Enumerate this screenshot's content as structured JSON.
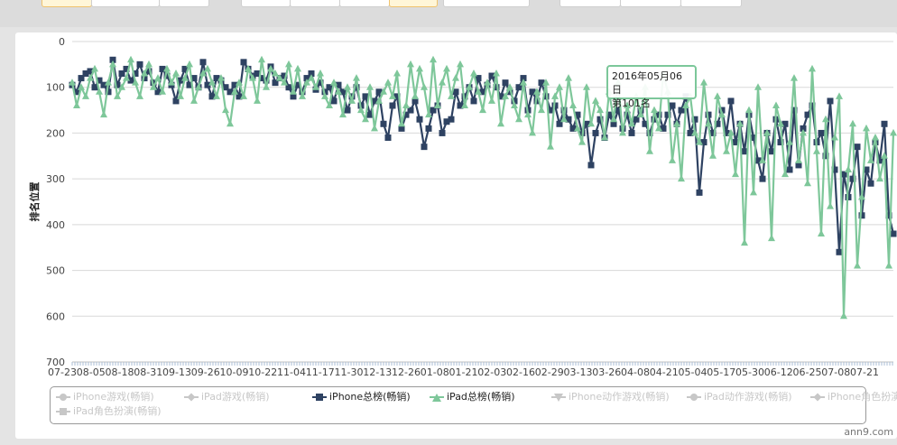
{
  "chart_data": {
    "type": "line",
    "ylabel": "排名位置",
    "ylim": [
      0,
      700
    ],
    "y_reversed": true,
    "yticks": [
      0,
      100,
      200,
      300,
      400,
      500,
      600,
      700
    ],
    "x_tick_labels": [
      "07-23",
      "08-05",
      "08-18",
      "08-31",
      "09-13",
      "09-26",
      "10-09",
      "10-22",
      "11-04",
      "11-17",
      "11-30",
      "12-13",
      "12-26",
      "01-08",
      "01-21",
      "02-03",
      "02-16",
      "02-29",
      "03-13",
      "03-26",
      "04-08",
      "04-21",
      "05-04",
      "05-17",
      "05-30",
      "06-12",
      "06-25",
      "07-08",
      "07-21"
    ],
    "series": [
      {
        "name": "iPhone总榜(畅销)",
        "color": "#2e4262",
        "marker": "square",
        "values": [
          95,
          110,
          80,
          70,
          65,
          100,
          85,
          95,
          110,
          40,
          95,
          70,
          60,
          85,
          70,
          50,
          80,
          65,
          90,
          110,
          60,
          75,
          95,
          130,
          85,
          60,
          95,
          80,
          100,
          45,
          95,
          120,
          80,
          85,
          100,
          110,
          95,
          120,
          45,
          60,
          75,
          70,
          80,
          85,
          55,
          90,
          80,
          75,
          100,
          120,
          95,
          110,
          80,
          70,
          105,
          90,
          110,
          100,
          130,
          95,
          110,
          150,
          120,
          100,
          140,
          120,
          160,
          130,
          110,
          180,
          210,
          140,
          120,
          190,
          160,
          150,
          130,
          170,
          230,
          190,
          150,
          140,
          200,
          175,
          170,
          110,
          140,
          120,
          100,
          130,
          80,
          110,
          95,
          75,
          100,
          120,
          90,
          110,
          130,
          100,
          80,
          150,
          110,
          130,
          90,
          120,
          150,
          140,
          180,
          150,
          170,
          190,
          160,
          200,
          180,
          270,
          200,
          170,
          210,
          160,
          180,
          150,
          190,
          160,
          200,
          170,
          150,
          180,
          200,
          170,
          160,
          190,
          160,
          140,
          180,
          150,
          120,
          200,
          170,
          330,
          220,
          160,
          200,
          180,
          150,
          200,
          130,
          220,
          180,
          240,
          160,
          210,
          260,
          300,
          200,
          240,
          170,
          220,
          180,
          280,
          150,
          270,
          190,
          160,
          140,
          220,
          200,
          250,
          130,
          280,
          460,
          290,
          340,
          300,
          230,
          380,
          280,
          310,
          220,
          260,
          180,
          380,
          420
        ]
      },
      {
        "name": "iPad总榜(畅销)",
        "color": "#7ec79a",
        "marker": "triangle",
        "values": [
          90,
          140,
          100,
          120,
          80,
          60,
          110,
          160,
          90,
          50,
          120,
          100,
          80,
          40,
          90,
          120,
          70,
          50,
          100,
          80,
          110,
          60,
          90,
          70,
          120,
          80,
          50,
          130,
          100,
          70,
          60,
          90,
          120,
          80,
          150,
          180,
          110,
          90,
          120,
          60,
          80,
          130,
          40,
          100,
          60,
          70,
          80,
          90,
          50,
          110,
          60,
          120,
          90,
          80,
          100,
          70,
          120,
          140,
          90,
          110,
          160,
          100,
          130,
          80,
          150,
          170,
          100,
          190,
          130,
          110,
          90,
          120,
          70,
          180,
          140,
          50,
          120,
          60,
          100,
          160,
          40,
          140,
          90,
          60,
          120,
          80,
          50,
          140,
          100,
          70,
          110,
          150,
          90,
          130,
          70,
          180,
          120,
          100,
          140,
          170,
          90,
          160,
          200,
          110,
          150,
          90,
          230,
          120,
          100,
          170,
          80,
          140,
          190,
          220,
          100,
          180,
          130,
          150,
          210,
          110,
          170,
          90,
          200,
          140,
          180,
          120,
          160,
          100,
          240,
          150,
          190,
          70,
          110,
          260,
          180,
          300,
          140,
          120,
          200,
          220,
          90,
          180,
          250,
          120,
          160,
          240,
          200,
          290,
          180,
          440,
          150,
          330,
          100,
          260,
          200,
          430,
          140,
          180,
          290,
          220,
          80,
          260,
          200,
          310,
          60,
          240,
          420,
          170,
          360,
          210,
          120,
          600,
          280,
          180,
          490,
          340,
          190,
          260,
          210,
          300,
          250,
          490,
          200
        ]
      }
    ],
    "legend": {
      "items": [
        {
          "label": "iPhone游戏(畅销)",
          "active": false,
          "marker": "circle"
        },
        {
          "label": "iPad游戏(畅销)",
          "active": false,
          "marker": "diamond"
        },
        {
          "label": "iPhone总榜(畅销)",
          "active": true,
          "marker": "square",
          "color": "#2e4262"
        },
        {
          "label": "iPad总榜(畅销)",
          "active": true,
          "marker": "triangle",
          "color": "#7ec79a"
        },
        {
          "label": "iPhone动作游戏(畅销)",
          "active": false,
          "marker": "triangle-down"
        },
        {
          "label": "iPad动作游戏(畅销)",
          "active": false,
          "marker": "circle"
        },
        {
          "label": "iPhone角色扮演(畅销)",
          "active": false,
          "marker": "diamond"
        },
        {
          "label": "iPad角色扮演(畅销)",
          "active": false,
          "marker": "square"
        }
      ]
    },
    "tooltip": {
      "date": "2016年05月06日",
      "rank": "第101名"
    },
    "grid": true
  },
  "credit": "ann9.com",
  "colors": {
    "inactive": "#c7c7c7",
    "grid": "#d8d8d8"
  }
}
